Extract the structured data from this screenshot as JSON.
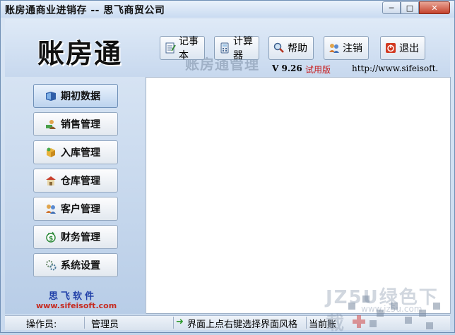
{
  "window": {
    "title": "账房通商业进销存 -- 思飞商贸公司",
    "controls": [
      "─",
      "□",
      "✕"
    ]
  },
  "header": {
    "logo": "账房通",
    "ghost_text": "账房通管理",
    "version": "V 9.26",
    "trial": "试用版",
    "url": "http://www.sifeisoft."
  },
  "toolbar": {
    "items": [
      {
        "label": "记事本",
        "icon": "notepad-icon"
      },
      {
        "label": "计算器",
        "icon": "calculator-icon"
      },
      {
        "label": "帮助",
        "icon": "help-icon"
      },
      {
        "label": "注销",
        "icon": "logout-icon"
      },
      {
        "label": "退出",
        "icon": "exit-icon"
      }
    ]
  },
  "sidebar": {
    "items": [
      {
        "label": "期初数据",
        "icon": "book-icon"
      },
      {
        "label": "销售管理",
        "icon": "sales-icon"
      },
      {
        "label": "入库管理",
        "icon": "box-icon"
      },
      {
        "label": "仓库管理",
        "icon": "warehouse-icon"
      },
      {
        "label": "客户管理",
        "icon": "customers-icon"
      },
      {
        "label": "财务管理",
        "icon": "finance-icon"
      },
      {
        "label": "系统设置",
        "icon": "settings-icon"
      }
    ],
    "brand_cn": "思飞软件",
    "brand_url": "www.sifeisoft.com"
  },
  "status": {
    "operator_label": "操作员:",
    "operator_value": "管理员",
    "hint": "界面上点右键选择界面风格",
    "account": "当前账"
  },
  "watermark": {
    "text": "JZ5U绿色下载",
    "sub": "www.jz5u.com"
  },
  "colors": {
    "accent": "#2140a8",
    "trial": "#c81818",
    "close": "#c5422d"
  }
}
